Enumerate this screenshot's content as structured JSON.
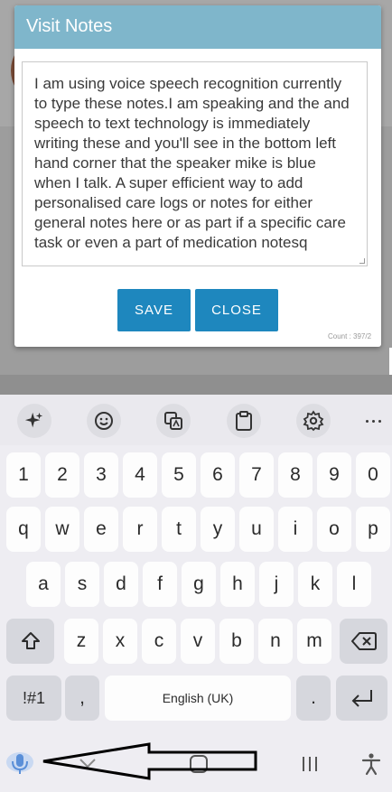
{
  "modal": {
    "title": "Visit Notes",
    "note_text": "I am using voice speech recognition currently to type these notes.I am speaking and the and speech to text technology is immediately writing these and you'll see in the bottom left hand corner that the speaker mike is blue when I talk. A super efficient way to add personalised care logs or notes for either general notes here or as part if a specific care task or even a part of medication notesq",
    "save_label": "SAVE",
    "close_label": "CLOSE",
    "count_text": "Count : 397/2"
  },
  "keyboard": {
    "toolbar_icons": [
      "sparkle-icon",
      "emoji-icon",
      "translate-icon",
      "clipboard-icon",
      "settings-icon",
      "more-icon"
    ],
    "number_row": [
      "1",
      "2",
      "3",
      "4",
      "5",
      "6",
      "7",
      "8",
      "9",
      "0"
    ],
    "row1": [
      "q",
      "w",
      "e",
      "r",
      "t",
      "y",
      "u",
      "i",
      "o",
      "p"
    ],
    "row2": [
      "a",
      "s",
      "d",
      "f",
      "g",
      "h",
      "j",
      "k",
      "l"
    ],
    "row3": [
      "z",
      "x",
      "c",
      "v",
      "b",
      "n",
      "m"
    ],
    "symbols_label": "!#1",
    "comma_label": ",",
    "space_label": "English (UK)",
    "period_label": "."
  },
  "navbar": {
    "icons": [
      "microphone-icon",
      "keyboard-hide-icon",
      "home-icon",
      "recents-icon",
      "accessibility-icon"
    ],
    "mic_color": "#5a8fd8"
  },
  "colors": {
    "modal_header": "#7fb6cb",
    "button": "#1e87be"
  }
}
